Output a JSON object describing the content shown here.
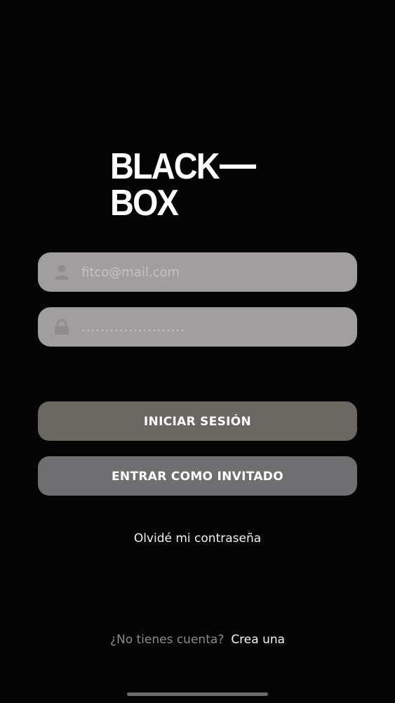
{
  "logo": {
    "line1": "BLACK",
    "line2": "BOX"
  },
  "login_form": {
    "email": {
      "placeholder": "fitco@mail.com",
      "value": "",
      "icon": "user-icon"
    },
    "password": {
      "placeholder": "",
      "value": "......................",
      "icon": "lock-icon"
    }
  },
  "buttons": {
    "login_label": "INICIAR SESIÓN",
    "guest_label": "ENTRAR COMO INVITADO"
  },
  "links": {
    "forgot_password": "Olvidé mi contraseña",
    "no_account": "¿No tienes cuenta?",
    "create_account": "Crea una"
  },
  "colors": {
    "background": "#050505",
    "field_bg": "#a19e9f",
    "login_button": "#6a6762",
    "guest_button": "#6f6e70",
    "text_primary": "#ffffff",
    "text_muted": "#8b8b8b"
  }
}
